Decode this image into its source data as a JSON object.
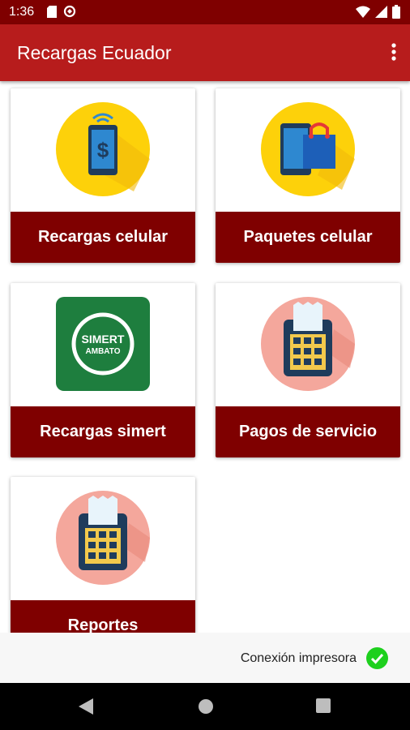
{
  "status_bar": {
    "time": "1:36"
  },
  "app_bar": {
    "title": "Recargas Ecuador"
  },
  "menu": [
    {
      "label": "Recargas celular",
      "icon": "phone-recharge-icon"
    },
    {
      "label": "Paquetes celular",
      "icon": "phone-shopping-bag-icon"
    },
    {
      "label": "Recargas simert",
      "icon": "simert-ambato-logo",
      "logo_text": [
        "SIMERT",
        "AMBATO"
      ]
    },
    {
      "label": "Pagos de servicio",
      "icon": "pos-terminal-icon"
    },
    {
      "label": "Reportes",
      "icon": "pos-terminal-icon"
    }
  ],
  "printer_status": {
    "label": "Conexión impresora",
    "connected": true
  },
  "colors": {
    "status_bar": "#7f0000",
    "app_bar": "#b71c1c",
    "card_label": "#7f0000",
    "success": "#1ed01e"
  }
}
